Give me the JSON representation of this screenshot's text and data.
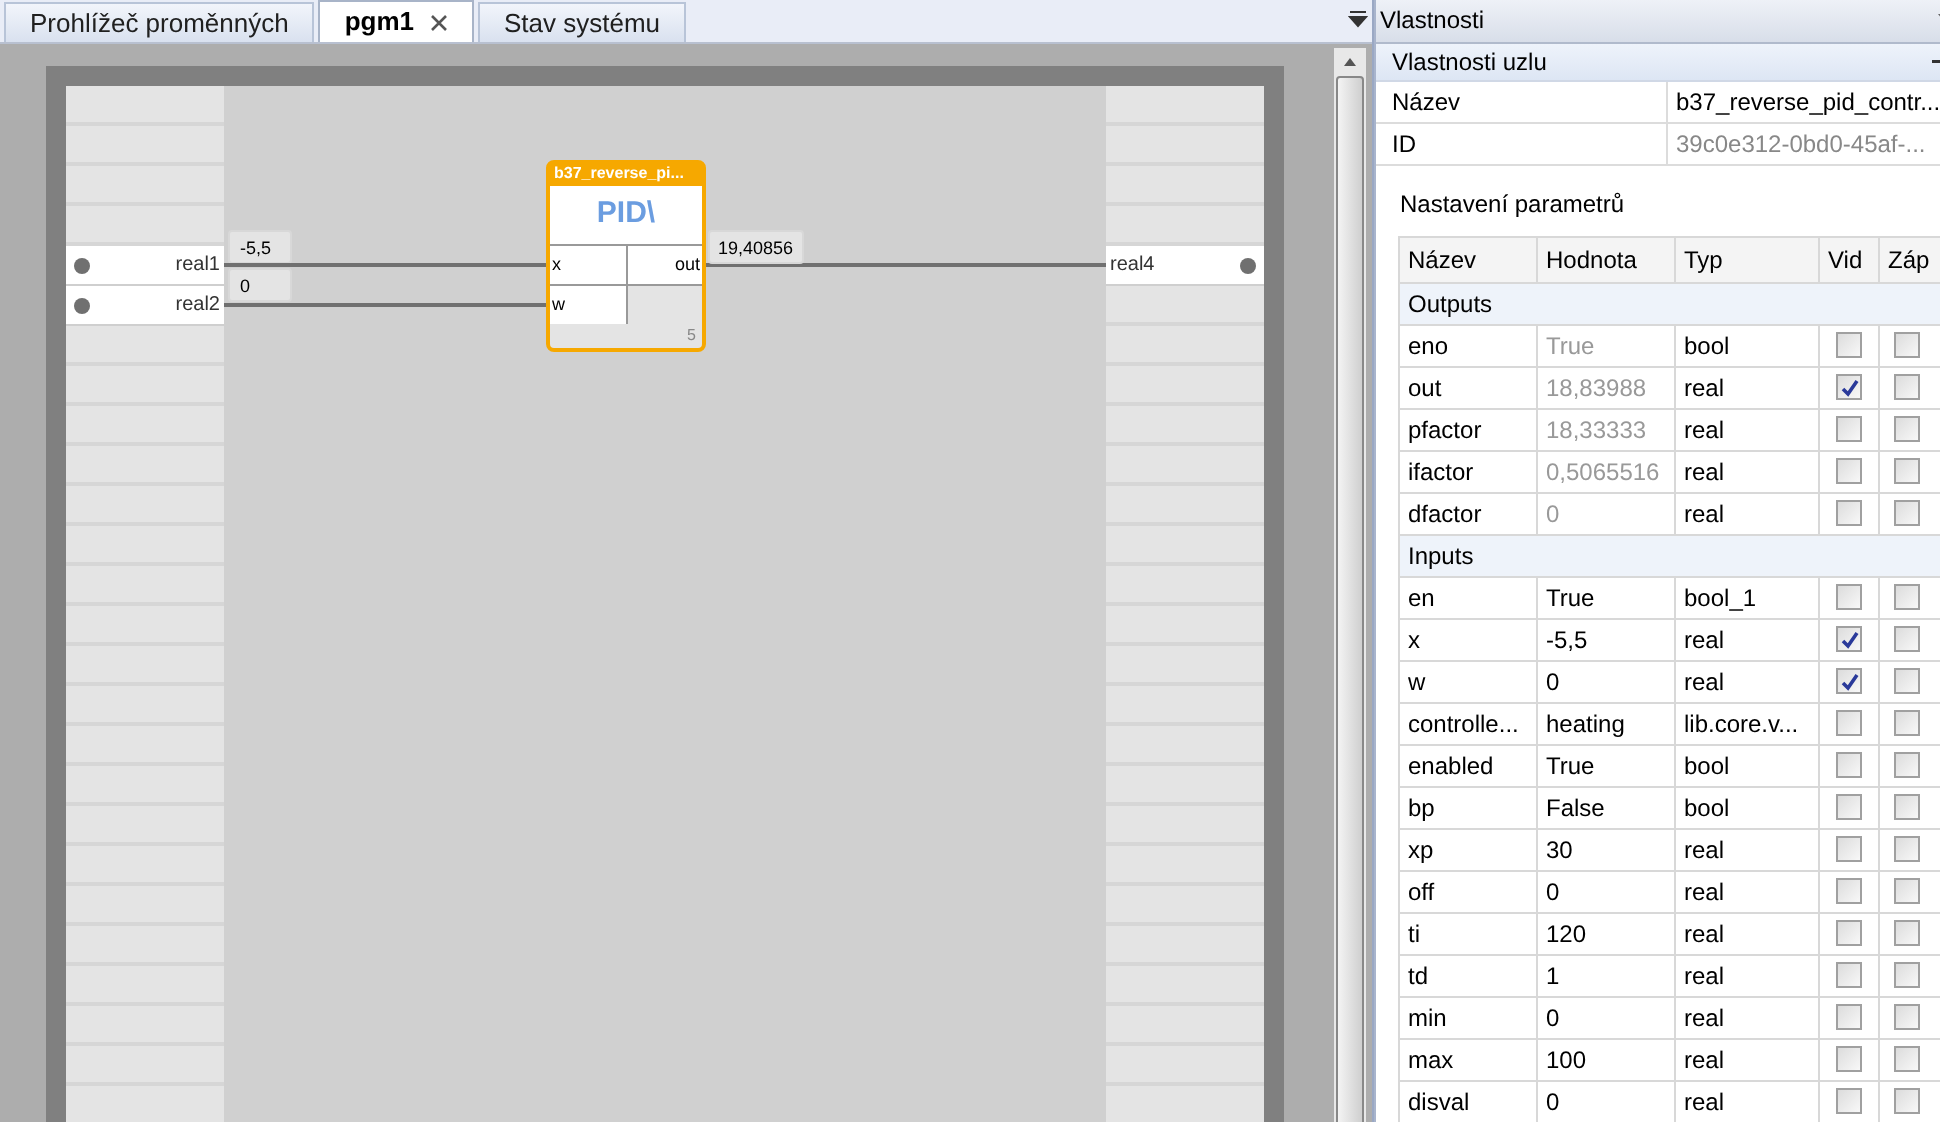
{
  "tabs": [
    {
      "label": "Prohlížeč proměnných",
      "selected": false,
      "closable": false
    },
    {
      "label": "pgm1",
      "selected": true,
      "closable": true
    },
    {
      "label": "Stav systému",
      "selected": false,
      "closable": false
    }
  ],
  "diagram": {
    "inputs": [
      {
        "name": "real1",
        "value": "-5,5"
      },
      {
        "name": "real2",
        "value": "0"
      }
    ],
    "outputs": [
      {
        "name": "real4"
      }
    ],
    "block": {
      "title": "b37_reverse_pi...",
      "symbol": "PID\\",
      "ports_in": [
        "x",
        "w"
      ],
      "ports_out": [
        "out"
      ],
      "out_value": "19,40856",
      "corner": "5"
    }
  },
  "properties": {
    "title": "Vlastnosti",
    "section": "Vlastnosti uzlu",
    "fields": [
      {
        "label": "Název",
        "value": "b37_reverse_pid_contr...",
        "muted": false
      },
      {
        "label": "ID",
        "value": "39c0e312-0bd0-45af-...",
        "muted": true
      }
    ],
    "params_title": "Nastavení parametrů",
    "columns": [
      "Název",
      "Hodnota",
      "Typ",
      "Vid",
      "Záp"
    ],
    "groups": [
      {
        "name": "Outputs",
        "rows": [
          {
            "name": "eno",
            "value": "True",
            "type": "bool",
            "readonly": true,
            "vid": false,
            "zap": false
          },
          {
            "name": "out",
            "value": "18,83988",
            "type": "real",
            "readonly": true,
            "vid": true,
            "zap": false
          },
          {
            "name": "pfactor",
            "value": "18,33333",
            "type": "real",
            "readonly": true,
            "vid": false,
            "zap": false
          },
          {
            "name": "ifactor",
            "value": "0,5065516",
            "type": "real",
            "readonly": true,
            "vid": false,
            "zap": false
          },
          {
            "name": "dfactor",
            "value": "0",
            "type": "real",
            "readonly": true,
            "vid": false,
            "zap": false
          }
        ]
      },
      {
        "name": "Inputs",
        "rows": [
          {
            "name": "en",
            "value": "True",
            "type": "bool_1",
            "readonly": false,
            "vid": false,
            "zap": false
          },
          {
            "name": "x",
            "value": "-5,5",
            "type": "real",
            "readonly": false,
            "vid": true,
            "zap": false
          },
          {
            "name": "w",
            "value": "0",
            "type": "real",
            "readonly": false,
            "vid": true,
            "zap": false
          },
          {
            "name": "controlle...",
            "value": "heating",
            "type": "lib.core.v...",
            "readonly": false,
            "vid": false,
            "zap": false
          },
          {
            "name": "enabled",
            "value": "True",
            "type": "bool",
            "readonly": false,
            "vid": false,
            "zap": false
          },
          {
            "name": "bp",
            "value": "False",
            "type": "bool",
            "readonly": false,
            "vid": false,
            "zap": false
          },
          {
            "name": "xp",
            "value": "30",
            "type": "real",
            "readonly": false,
            "vid": false,
            "zap": false
          },
          {
            "name": "off",
            "value": "0",
            "type": "real",
            "readonly": false,
            "vid": false,
            "zap": false
          },
          {
            "name": "ti",
            "value": "120",
            "type": "real",
            "readonly": false,
            "vid": false,
            "zap": false
          },
          {
            "name": "td",
            "value": "1",
            "type": "real",
            "readonly": false,
            "vid": false,
            "zap": false
          },
          {
            "name": "min",
            "value": "0",
            "type": "real",
            "readonly": false,
            "vid": false,
            "zap": false
          },
          {
            "name": "max",
            "value": "100",
            "type": "real",
            "readonly": false,
            "vid": false,
            "zap": false
          },
          {
            "name": "disval",
            "value": "0",
            "type": "real",
            "readonly": false,
            "vid": false,
            "zap": false
          }
        ]
      }
    ]
  }
}
